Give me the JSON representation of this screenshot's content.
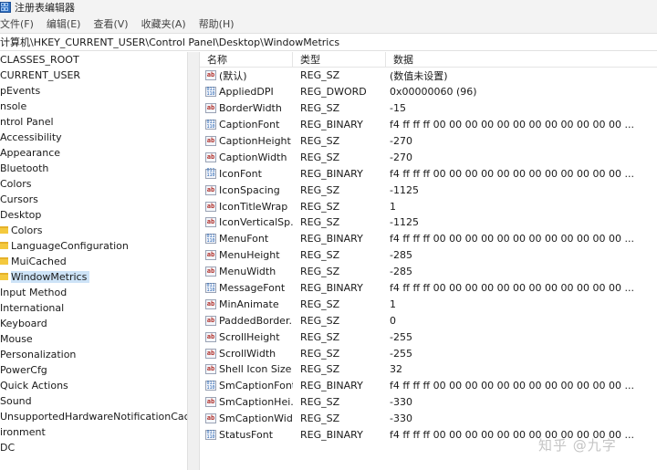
{
  "window": {
    "title": "注册表编辑器"
  },
  "menu": [
    "文件(F)",
    "编辑(E)",
    "查看(V)",
    "收藏夹(A)",
    "帮助(H)"
  ],
  "address": "计算机\\HKEY_CURRENT_USER\\Control Panel\\Desktop\\WindowMetrics",
  "tree": [
    {
      "label": "CLASSES_ROOT",
      "folder": false
    },
    {
      "label": "CURRENT_USER",
      "folder": false
    },
    {
      "label": "pEvents",
      "folder": false
    },
    {
      "label": "nsole",
      "folder": false
    },
    {
      "label": "ntrol Panel",
      "folder": false
    },
    {
      "label": "Accessibility",
      "folder": false
    },
    {
      "label": "Appearance",
      "folder": false
    },
    {
      "label": "Bluetooth",
      "folder": false
    },
    {
      "label": "Colors",
      "folder": false
    },
    {
      "label": "Cursors",
      "folder": false
    },
    {
      "label": "Desktop",
      "folder": false
    },
    {
      "label": "Colors",
      "folder": true
    },
    {
      "label": "LanguageConfiguration",
      "folder": true
    },
    {
      "label": "MuiCached",
      "folder": true
    },
    {
      "label": "WindowMetrics",
      "folder": true,
      "selected": true
    },
    {
      "label": "Input Method",
      "folder": false
    },
    {
      "label": "International",
      "folder": false
    },
    {
      "label": "Keyboard",
      "folder": false
    },
    {
      "label": "Mouse",
      "folder": false
    },
    {
      "label": "Personalization",
      "folder": false
    },
    {
      "label": "PowerCfg",
      "folder": false
    },
    {
      "label": "Quick Actions",
      "folder": false
    },
    {
      "label": "Sound",
      "folder": false
    },
    {
      "label": "UnsupportedHardwareNotificationCache",
      "folder": false
    },
    {
      "label": "ironment",
      "folder": false
    },
    {
      "label": "DC",
      "folder": false
    }
  ],
  "columns": {
    "name": "名称",
    "type": "类型",
    "data": "数据"
  },
  "icon_labels": {
    "string": "ab",
    "binary": "011\n110"
  },
  "values": [
    {
      "name": "(默认)",
      "type": "REG_SZ",
      "data": "(数值未设置)",
      "icon": "string"
    },
    {
      "name": "AppliedDPI",
      "type": "REG_DWORD",
      "data": "0x00000060 (96)",
      "icon": "binary"
    },
    {
      "name": "BorderWidth",
      "type": "REG_SZ",
      "data": "-15",
      "icon": "string"
    },
    {
      "name": "CaptionFont",
      "type": "REG_BINARY",
      "data": "f4 ff ff ff 00 00 00 00 00 00 00 00 00 00 00 00 ...",
      "icon": "binary"
    },
    {
      "name": "CaptionHeight",
      "type": "REG_SZ",
      "data": "-270",
      "icon": "string"
    },
    {
      "name": "CaptionWidth",
      "type": "REG_SZ",
      "data": "-270",
      "icon": "string"
    },
    {
      "name": "IconFont",
      "type": "REG_BINARY",
      "data": "f4 ff ff ff 00 00 00 00 00 00 00 00 00 00 00 00 ...",
      "icon": "binary"
    },
    {
      "name": "IconSpacing",
      "type": "REG_SZ",
      "data": "-1125",
      "icon": "string"
    },
    {
      "name": "IconTitleWrap",
      "type": "REG_SZ",
      "data": "1",
      "icon": "string"
    },
    {
      "name": "IconVerticalSp...",
      "type": "REG_SZ",
      "data": "-1125",
      "icon": "string"
    },
    {
      "name": "MenuFont",
      "type": "REG_BINARY",
      "data": "f4 ff ff ff 00 00 00 00 00 00 00 00 00 00 00 00 ...",
      "icon": "binary"
    },
    {
      "name": "MenuHeight",
      "type": "REG_SZ",
      "data": "-285",
      "icon": "string"
    },
    {
      "name": "MenuWidth",
      "type": "REG_SZ",
      "data": "-285",
      "icon": "string"
    },
    {
      "name": "MessageFont",
      "type": "REG_BINARY",
      "data": "f4 ff ff ff 00 00 00 00 00 00 00 00 00 00 00 00 ...",
      "icon": "binary"
    },
    {
      "name": "MinAnimate",
      "type": "REG_SZ",
      "data": "1",
      "icon": "string"
    },
    {
      "name": "PaddedBorder...",
      "type": "REG_SZ",
      "data": "0",
      "icon": "string"
    },
    {
      "name": "ScrollHeight",
      "type": "REG_SZ",
      "data": "-255",
      "icon": "string"
    },
    {
      "name": "ScrollWidth",
      "type": "REG_SZ",
      "data": "-255",
      "icon": "string"
    },
    {
      "name": "Shell Icon Size",
      "type": "REG_SZ",
      "data": "32",
      "icon": "string"
    },
    {
      "name": "SmCaptionFont",
      "type": "REG_BINARY",
      "data": "f4 ff ff ff 00 00 00 00 00 00 00 00 00 00 00 00 ...",
      "icon": "binary"
    },
    {
      "name": "SmCaptionHei...",
      "type": "REG_SZ",
      "data": "-330",
      "icon": "string"
    },
    {
      "name": "SmCaptionWid...",
      "type": "REG_SZ",
      "data": "-330",
      "icon": "string"
    },
    {
      "name": "StatusFont",
      "type": "REG_BINARY",
      "data": "f4 ff ff ff 00 00 00 00 00 00 00 00 00 00 00 00 ...",
      "icon": "binary"
    }
  ],
  "watermark": "知乎 @九字"
}
